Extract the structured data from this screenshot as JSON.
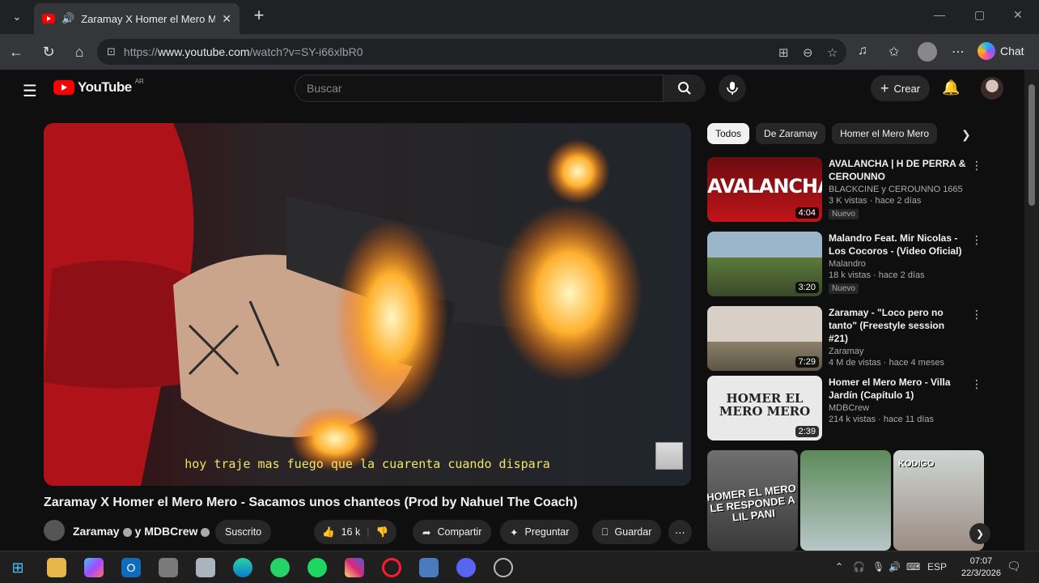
{
  "browser": {
    "tab_title": "Zaramay X Homer el Mero Me",
    "url_scheme": "https://",
    "url_host": "www.youtube.com",
    "url_path": "/watch?v=SY-i66xlbR0",
    "chat_label": "Chat"
  },
  "youtube": {
    "logo_text": "YouTube",
    "logo_region": "AR",
    "search_placeholder": "Buscar",
    "create_label": "Crear"
  },
  "video": {
    "subtitle": "hoy traje mas fuego que la cuarenta cuando dispara",
    "title": "Zaramay X Homer el Mero Mero - Sacamos unos chanteos (Prod by Nahuel The Coach)",
    "channel_a": "Zaramay",
    "channel_b": "y MDBCrew",
    "subscribed": "Suscrito",
    "likes": "16 k",
    "share": "Compartir",
    "ask": "Preguntar",
    "save": "Guardar"
  },
  "chips": [
    "Todos",
    "De Zaramay",
    "Homer el Mero Mero"
  ],
  "recommendations": [
    {
      "title": "AVALANCHA | H DE PERRA & CEROUNNO",
      "channel": "BLACKCINE y CEROUNNO 1665",
      "meta": "3 K vistas · hace 2 días",
      "badge": "Nuevo",
      "duration": "4:04",
      "thumb_text": "AVALANCHA"
    },
    {
      "title": "Malandro Feat. Mir Nicolas - Los Cocoros - (Video Oficial)",
      "channel": "Malandro",
      "meta": "18 k vistas · hace 2 días",
      "badge": "Nuevo",
      "duration": "3:20"
    },
    {
      "title": "Zaramay - \"Loco pero no tanto\" (Freestyle session #21)",
      "channel": "Zaramay",
      "meta": "4 M de vistas · hace 4 meses",
      "badge": "",
      "duration": "7:29"
    },
    {
      "title": "Homer el Mero Mero - Villa Jardín (Capítulo 1)",
      "channel": "MDBCrew",
      "meta": "214 k vistas · hace 11 días",
      "badge": "",
      "duration": "2:39",
      "thumb_text": "HOMER EL MERO MERO"
    }
  ],
  "shorts": [
    {
      "caption": "HOMER EL MERO LE RESPONDE A LIL PANI"
    },
    {
      "caption": ""
    },
    {
      "caption": "KODIGO"
    }
  ],
  "taskbar": {
    "lang": "ESP",
    "time": "07:07",
    "date": "22/3/2026"
  },
  "colors": {
    "yt_red": "#ff0000",
    "bg": "#0f0f0f",
    "chip_bg": "#272727",
    "subtitle_yellow": "#f0e46a"
  }
}
